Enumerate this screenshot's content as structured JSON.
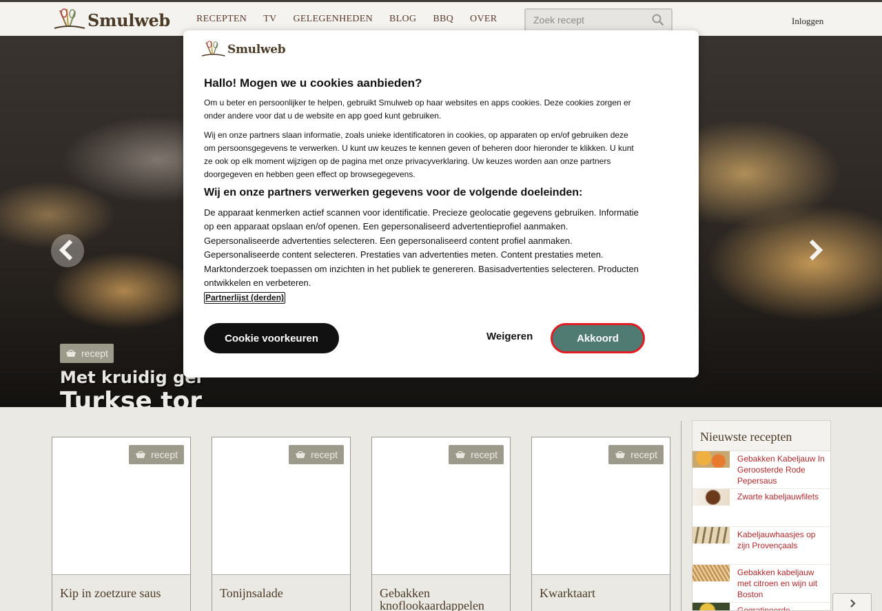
{
  "header": {
    "logo_text": "Smulweb",
    "nav": [
      "RECEPTEN",
      "TV",
      "GELEGENHEDEN",
      "BLOG",
      "BBQ",
      "OVER"
    ],
    "search_placeholder": "Zoek recept",
    "login": "Inloggen"
  },
  "hero": {
    "badge": "recept",
    "subtitle": "Met kruidig gel",
    "title": "Turkse tor"
  },
  "cookie_modal": {
    "logo_text": "Smulweb",
    "heading": "Hallo! Mogen we u cookies aanbieden?",
    "para1": "Om u beter en persoonlijker te helpen, gebruikt Smulweb op haar websites en apps cookies. Deze cookies zorgen er onder andere voor dat u de website en app goed kunt gebruiken.",
    "para2": "Wij en onze partners slaan informatie, zoals unieke identificatoren in cookies, op apparaten op en/of gebruiken deze om persoonsgegevens te verwerken. U kunt uw keuzes te kennen geven of beheren door hieronder te klikken. U kunt ze ook op elk moment wijzigen op de pagina met onze privacyverklaring. Uw keuzes worden aan onze partners doorgegeven en hebben geen effect op browsegegevens.",
    "heading2": "Wij en onze partners verwerken gegevens voor de volgende doeleinden:",
    "purposes": "De apparaat kenmerken actief scannen voor identificatie. Precieze geolocatie gegevens gebruiken. Informatie op een apparaat opslaan en/of openen. Een gepersonaliseerd advertentieprofiel aanmaken. Gepersonaliseerde advertenties selecteren. Een gepersonaliseerd content profiel aanmaken. Gepersonaliseerde content selecteren. Prestaties van advertenties meten. Content prestaties meten. Marktonderzoek toepassen om inzichten in het publiek te genereren. Basisadvertenties selecteren. Producten ontwikkelen en verbeteren.",
    "partner_link": "Partnerlijst (derden)",
    "btn_preferences": "Cookie voorkeuren",
    "btn_reject": "Weigeren",
    "btn_accept": "Akkoord"
  },
  "cards": [
    {
      "badge": "recept",
      "title": "Kip in zoetzure saus"
    },
    {
      "badge": "recept",
      "title": "Tonijnsalade"
    },
    {
      "badge": "recept",
      "title": "Gebakken knoflookaardappelen"
    },
    {
      "badge": "recept",
      "title": "Kwarktaart"
    }
  ],
  "sidebar": {
    "title": "Nieuwste recepten",
    "items": [
      "Gebakken Kabeljauw In Geroosterde Rode Pepersaus",
      "Zwarte kabeljauwfilets",
      "Kabeljauwhaasjes op zijn Provençaals",
      "Gebakken kabeljauw met citroen en wijn uit Boston",
      "Gegratineerde"
    ]
  },
  "colors": {
    "accent": "#4f7b73",
    "accept_border": "#e31b23",
    "link_red": "#b0292c",
    "brand_brown": "#4b3a26",
    "badge_bg": "#9c9a8a"
  },
  "icons": [
    "logo-whisk-icon",
    "search-icon",
    "chevron-left-icon",
    "chevron-right-icon",
    "basket-icon"
  ]
}
